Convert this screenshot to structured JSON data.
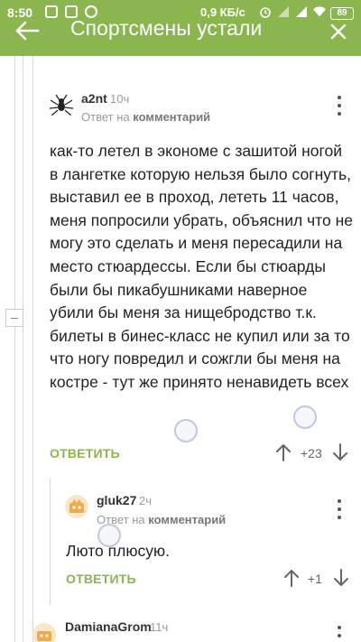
{
  "status_bar": {
    "time": "8:50",
    "network_speed": "0,9 КБ/с",
    "battery": "89"
  },
  "header": {
    "title": "Спортсмены устали"
  },
  "comments": [
    {
      "username": "a2nt",
      "time": "10ч",
      "reply_prefix": "Ответ на",
      "reply_target": "комментарий",
      "text": "как-то летел в экономе с зашитой ногой в лангетке которую нельзя было согнуть, выставил ее в проход, лететь 11 часов, меня попросили убрать, объяснил что не могу это сделать и меня пересадили на место стюардессы. Если бы стюарды были бы пикабушниками наверное убили бы меня за нищебродство т.к. билеты в бинес-класс не купил или за то что ногу повредил и сожгли бы меня на костре - тут же принято ненавидеть всех",
      "reply_label": "ОТВЕТИТЬ",
      "rating": "+23",
      "avatar_icon": "spider-avatar-icon"
    },
    {
      "username": "gluk27",
      "time": "2ч",
      "reply_prefix": "Ответ на",
      "reply_target": "комментарий",
      "text": "Люто плюсую.",
      "reply_label": "ОТВЕТИТЬ",
      "rating": "+1",
      "avatar_icon": "pikabu-avatar-icon"
    },
    {
      "username": "DamianaGrom",
      "time": "11ч",
      "avatar_icon": "pikabu-avatar-icon"
    }
  ],
  "colors": {
    "accent": "#8ab54f",
    "muted": "#9a9a9a"
  }
}
